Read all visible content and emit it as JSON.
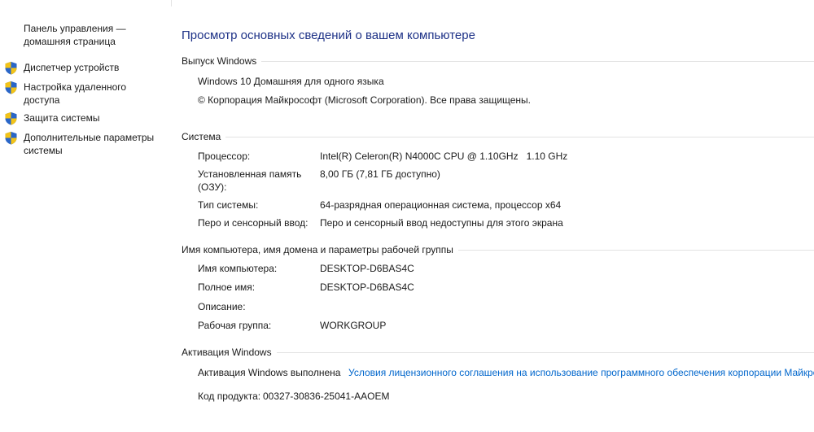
{
  "sidebar": {
    "home": "Панель управления —\nдомашняя страница",
    "items": [
      {
        "label": "Диспетчер устройств"
      },
      {
        "label": "Настройка удаленного\nдоступа"
      },
      {
        "label": "Защита системы"
      },
      {
        "label": "Дополнительные параметры\nсистемы"
      }
    ]
  },
  "main": {
    "title": "Просмотр основных сведений о вашем компьютере",
    "edition": {
      "heading": "Выпуск Windows",
      "name": "Windows 10 Домашняя для одного языка",
      "copyright": "© Корпорация Майкрософт (Microsoft Corporation). Все права защищены."
    },
    "system": {
      "heading": "Система",
      "processor_label": "Процессор:",
      "processor_value": "Intel(R) Celeron(R) N4000C CPU @ 1.10GHz   1.10 GHz",
      "memory_label": "Установленная память\n(ОЗУ):",
      "memory_value": "8,00 ГБ (7,81 ГБ доступно)",
      "type_label": "Тип системы:",
      "type_value": "64-разрядная операционная система, процессор x64",
      "pen_label": "Перо и сенсорный ввод:",
      "pen_value": "Перо и сенсорный ввод недоступны для этого экрана"
    },
    "computer": {
      "heading": "Имя компьютера, имя домена и параметры рабочей группы",
      "name_label": "Имя компьютера:",
      "name_value": "DESKTOP-D6BAS4C",
      "fullname_label": "Полное имя:",
      "fullname_value": "DESKTOP-D6BAS4C",
      "description_label": "Описание:",
      "description_value": "",
      "workgroup_label": "Рабочая группа:",
      "workgroup_value": "WORKGROUP"
    },
    "activation": {
      "heading": "Активация Windows",
      "status": "Активация Windows выполнена",
      "license_link": "Условия лицензионного соглашения на использование программного обеспечения корпорации Майкрософт",
      "product_id_label": "Код продукта:",
      "product_id_value": "00327-30836-25041-AAOEM"
    }
  },
  "colors": {
    "title": "#1e3287",
    "link": "#0066cc",
    "shield_blue": "#2a66c8",
    "shield_yellow": "#f2c318"
  },
  "icons": {
    "sidebar_item_icon": "shield-icon"
  }
}
